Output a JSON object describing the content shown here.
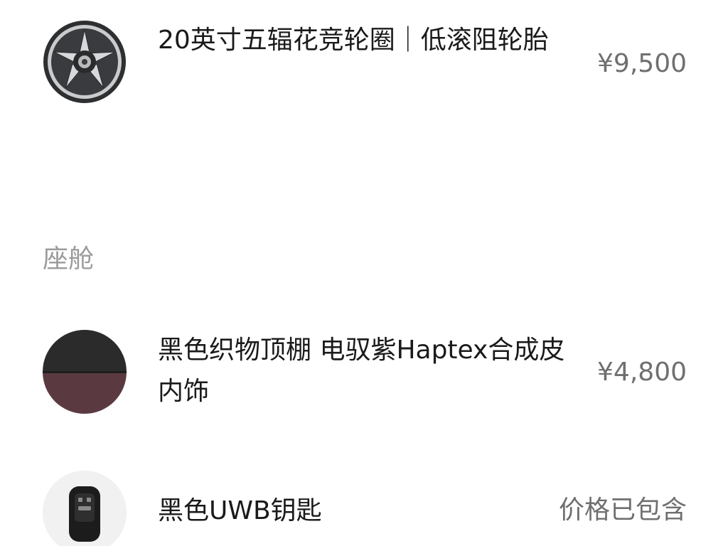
{
  "sections": {
    "cabin_title": "座舱"
  },
  "items": [
    {
      "name": "20英寸五辐花竞轮圈｜低滚阻轮胎",
      "price": "¥9,500",
      "icon": "wheel-icon"
    },
    {
      "name": "黑色织物顶棚 电驭紫Haptex合成皮内饰",
      "price": "¥4,800",
      "icon": "interior-swatch-icon"
    },
    {
      "name": "黑色UWB钥匙",
      "price": "价格已包含",
      "icon": "uwb-key-icon"
    }
  ],
  "colors": {
    "text_primary": "#1a1a1a",
    "text_price": "#6f6f6f",
    "text_section": "#9b9b9b",
    "swatch_top": "#2b2b2b",
    "swatch_bottom": "#5a3a40"
  }
}
